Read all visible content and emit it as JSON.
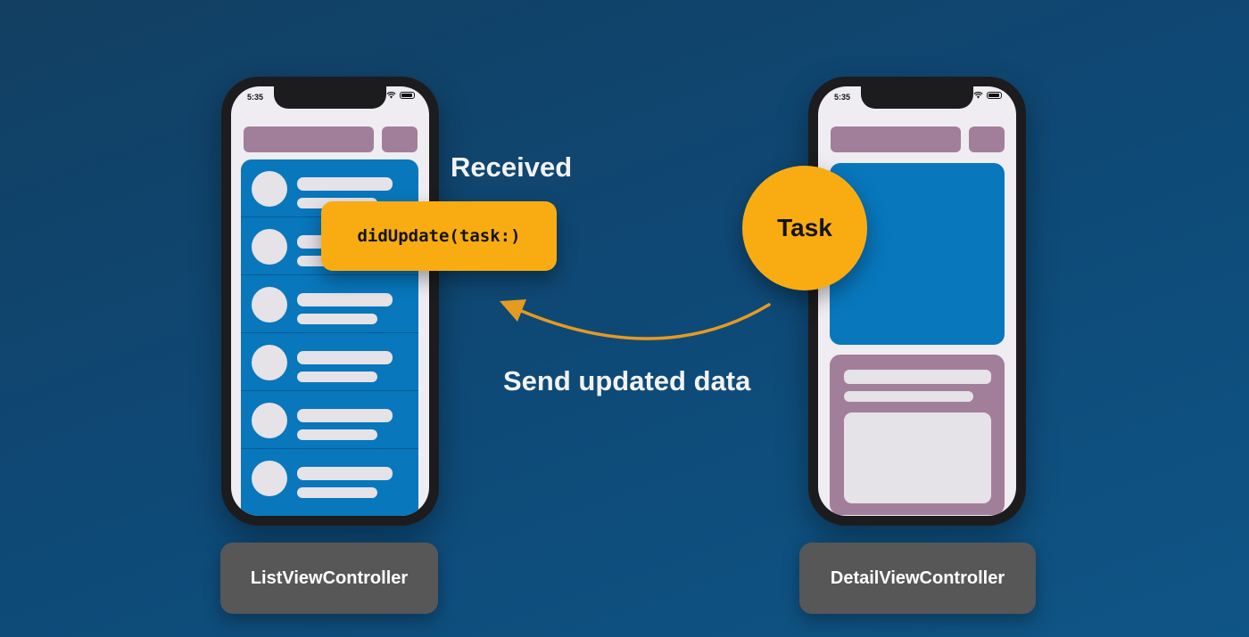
{
  "left_phone": {
    "status_time": "5:35",
    "list_row_count": 6
  },
  "right_phone": {
    "status_time": "5:35"
  },
  "labels": {
    "received": "Received",
    "method": "didUpdate(task:)",
    "task": "Task",
    "send": "Send updated data",
    "list_vc": "ListViewController",
    "detail_vc": "DetailViewController"
  },
  "colors": {
    "accent_orange": "#f9ac12",
    "panel_blue": "#0877bc",
    "bar_mauve": "#a17f9b",
    "label_gray": "#575757"
  }
}
